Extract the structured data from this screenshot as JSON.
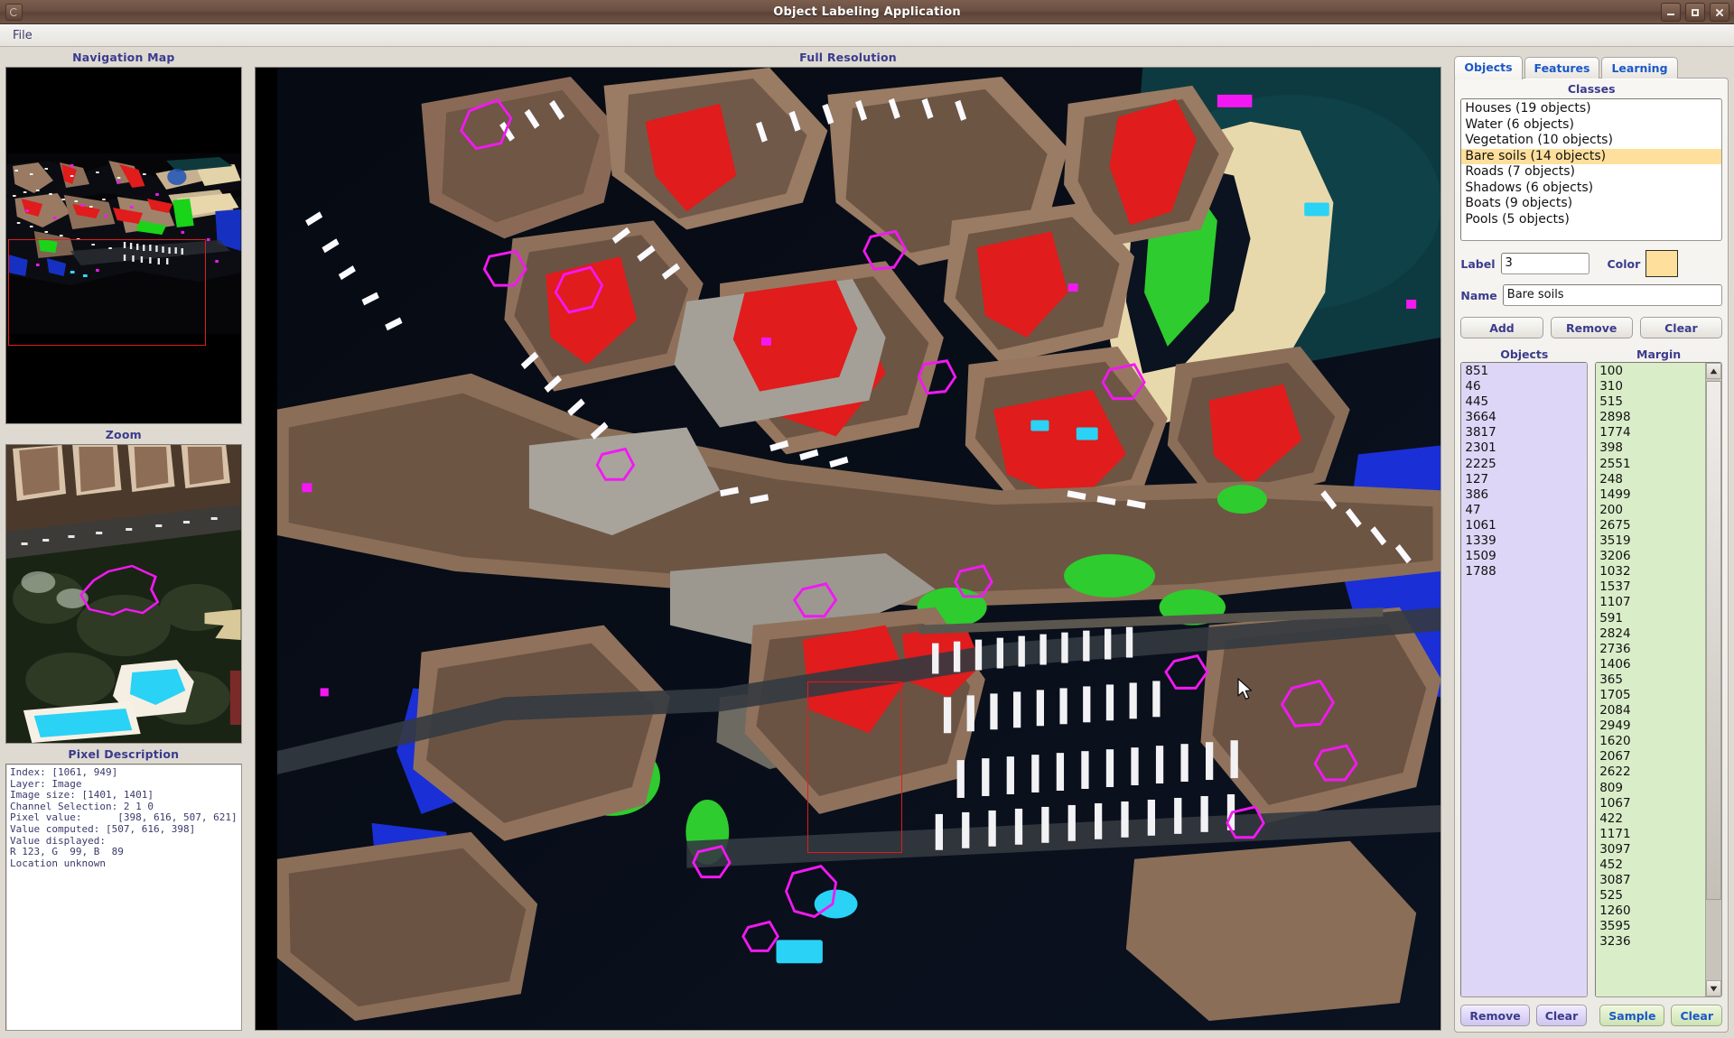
{
  "window": {
    "title": "Object Labeling Application",
    "controls": [
      "minimize",
      "maximize",
      "close"
    ]
  },
  "menubar": {
    "items": [
      "File"
    ]
  },
  "left": {
    "navigation_map": {
      "title": "Navigation Map"
    },
    "zoom": {
      "title": "Zoom"
    },
    "pixel_description": {
      "title": "Pixel Description",
      "text": "Index: [1061, 949]\nLayer: Image\nImage size: [1401, 1401]\nChannel Selection: 2 1 0\nPixel value:      [398, 616, 507, 621]\nValue computed: [507, 616, 398]\nValue displayed:\nR 123, G  99, B  89\nLocation unknown"
    }
  },
  "center": {
    "title": "Full Resolution"
  },
  "right": {
    "tabs": [
      {
        "label": "Objects",
        "active": true
      },
      {
        "label": "Features",
        "active": false
      },
      {
        "label": "Learning",
        "active": false
      }
    ],
    "classes": {
      "title": "Classes",
      "items": [
        {
          "label": "Houses (19 objects)",
          "selected": false
        },
        {
          "label": "Water (6 objects)",
          "selected": false
        },
        {
          "label": "Vegetation (10 objects)",
          "selected": false
        },
        {
          "label": "Bare soils (14 objects)",
          "selected": true
        },
        {
          "label": "Roads (7 objects)",
          "selected": false
        },
        {
          "label": "Shadows (6 objects)",
          "selected": false
        },
        {
          "label": "Boats (9 objects)",
          "selected": false
        },
        {
          "label": "Pools (5 objects)",
          "selected": false
        }
      ]
    },
    "label_field": {
      "label": "Label",
      "value": "3"
    },
    "color_field": {
      "label": "Color",
      "value": "#ffdf9c"
    },
    "name_field": {
      "label": "Name",
      "value": "Bare soils"
    },
    "class_buttons": [
      "Add",
      "Remove",
      "Clear"
    ],
    "objects_list": {
      "header": "Objects",
      "values": [
        "851",
        "46",
        "445",
        "3664",
        "3817",
        "2301",
        "2225",
        "127",
        "386",
        "47",
        "1061",
        "1339",
        "1509",
        "1788"
      ]
    },
    "margin_list": {
      "header": "Margin",
      "values": [
        "100",
        "310",
        "515",
        "2898",
        "1774",
        "398",
        "2551",
        "248",
        "1499",
        "200",
        "2675",
        "3519",
        "3206",
        "1032",
        "1537",
        "1107",
        "591",
        "2824",
        "2736",
        "1406",
        "365",
        "1705",
        "2084",
        "2949",
        "1620",
        "2067",
        "2622",
        "809",
        "1067",
        "422",
        "1171",
        "3097",
        "452",
        "3087",
        "525",
        "1260",
        "3595",
        "3236"
      ]
    },
    "bottom_buttons": [
      {
        "label": "Remove",
        "style": "purple"
      },
      {
        "label": "Clear",
        "style": "purple"
      },
      {
        "label": "Sample",
        "style": "green"
      },
      {
        "label": "Clear",
        "style": "green"
      }
    ]
  },
  "colors": {
    "selection_rect": "#e01c1c",
    "class_highlight": "#ffdf9c",
    "objects_list_bg": "#ddd6f6",
    "margin_list_bg": "#d9edc9",
    "accent_text": "#3b3b8c",
    "tab_text": "#1a58c8"
  }
}
